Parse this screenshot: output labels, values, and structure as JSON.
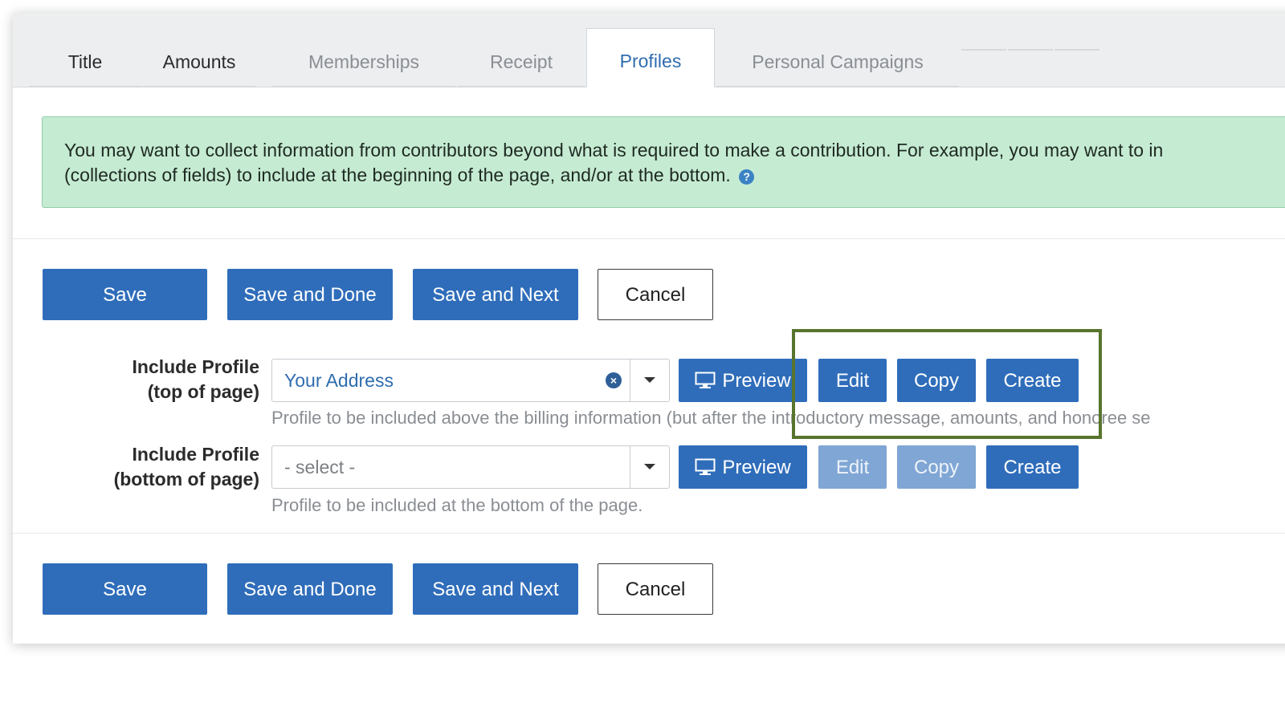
{
  "tabs": [
    {
      "label": "Title"
    },
    {
      "label": "Amounts"
    },
    {
      "label": "Memberships"
    },
    {
      "label": "Receipt"
    },
    {
      "label": "Profiles"
    },
    {
      "label": "Personal Campaigns"
    }
  ],
  "alert": {
    "line1": "You may want to collect information from contributors beyond what is required to make a contribution. For example, you may want to in",
    "line2": "(collections of fields) to include at the beginning of the page, and/or at the bottom.",
    "help_icon": "?"
  },
  "actions": {
    "save": "Save",
    "save_done": "Save and Done",
    "save_next": "Save and Next",
    "cancel": "Cancel"
  },
  "profile_top": {
    "label_line1": "Include Profile",
    "label_line2": "(top of page)",
    "value": "Your Address",
    "preview": "Preview",
    "edit": "Edit",
    "copy": "Copy",
    "create": "Create",
    "help": "Profile to be included above the billing information (but after the introductory message, amounts, and honoree se"
  },
  "profile_bottom": {
    "label_line1": "Include Profile",
    "label_line2": "(bottom of page)",
    "placeholder": "- select -",
    "preview": "Preview",
    "edit": "Edit",
    "copy": "Copy",
    "create": "Create",
    "help": "Profile to be included at the bottom of the page."
  },
  "icons": {
    "clear": "×",
    "monitor": "monitor-icon",
    "caret": "chevron-down-icon"
  },
  "colors": {
    "primary": "#2f6dba",
    "alert_bg": "#c6ebd3",
    "highlight": "#57752d",
    "active_tab": "#2f6dae"
  }
}
